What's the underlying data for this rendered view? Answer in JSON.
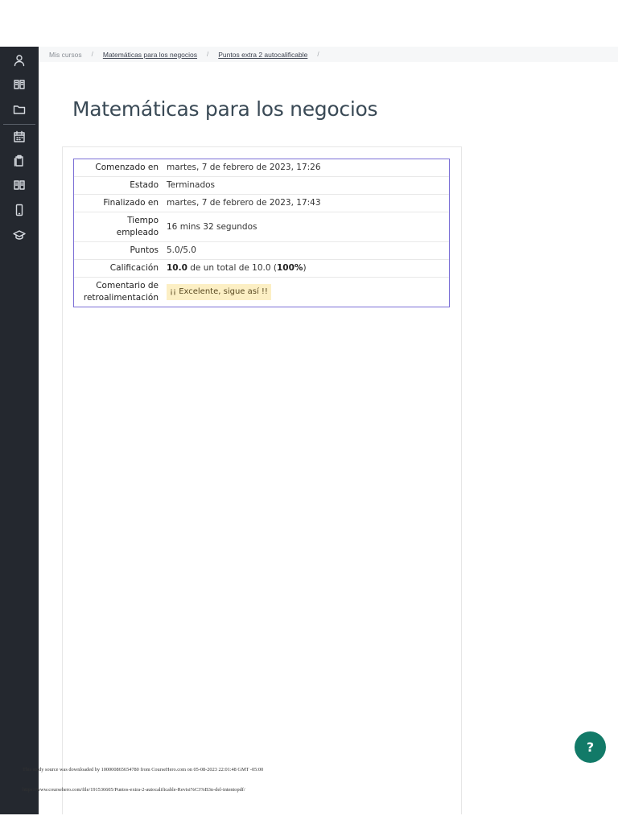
{
  "sidebar": {
    "items": [
      {
        "icon": "user-icon"
      },
      {
        "icon": "book-icon"
      },
      {
        "icon": "folder-icon"
      },
      {
        "icon": "calendar-icon"
      },
      {
        "icon": "clipboard-icon"
      },
      {
        "icon": "book-open-icon"
      },
      {
        "icon": "mobile-icon"
      },
      {
        "icon": "graduation-cap-icon"
      }
    ]
  },
  "breadcrumb": {
    "items": [
      {
        "label": "Mis cursos"
      },
      {
        "label": "Matemáticas para los negocios"
      },
      {
        "label": "Puntos extra 2 autocalificable"
      }
    ],
    "separator": "/"
  },
  "page": {
    "title": "Matemáticas para los negocios"
  },
  "summary": {
    "started_label": "Comenzado en",
    "started_value": "martes, 7 de febrero de 2023, 17:26",
    "state_label": "Estado",
    "state_value": "Terminados",
    "finished_label": "Finalizado en",
    "finished_value": "martes, 7 de febrero de 2023, 17:43",
    "time_label_line1": "Tiempo",
    "time_label_line2": "empleado",
    "time_value": "16 mins 32 segundos",
    "points_label": "Puntos",
    "points_value": "5.0/5.0",
    "grade_label": "Calificación",
    "grade_score": "10.0",
    "grade_mid": " de un total de 10.0 (",
    "grade_percent": "100%",
    "grade_end": ")",
    "feedback_label_line1": "Comentario de",
    "feedback_label_line2": "retroalimentación",
    "feedback_value": "¡¡ Excelente, sigue así !!"
  },
  "help": {
    "label": "?"
  },
  "footer": {
    "line1": "This study source was downloaded by 100000865654780 from CourseHero.com on 05-08-2023 22:01:48 GMT -05:00",
    "line2": "https://www.coursehero.com/file/191536605/Puntos-extra-2-autocalificable-Revisi%C3%B3n-del-intentopdf/"
  },
  "colors": {
    "sidebar": "#24282f",
    "accent_border": "#7b6fd6",
    "help_button": "#127a68",
    "feedback_bg": "#fcefc4"
  }
}
